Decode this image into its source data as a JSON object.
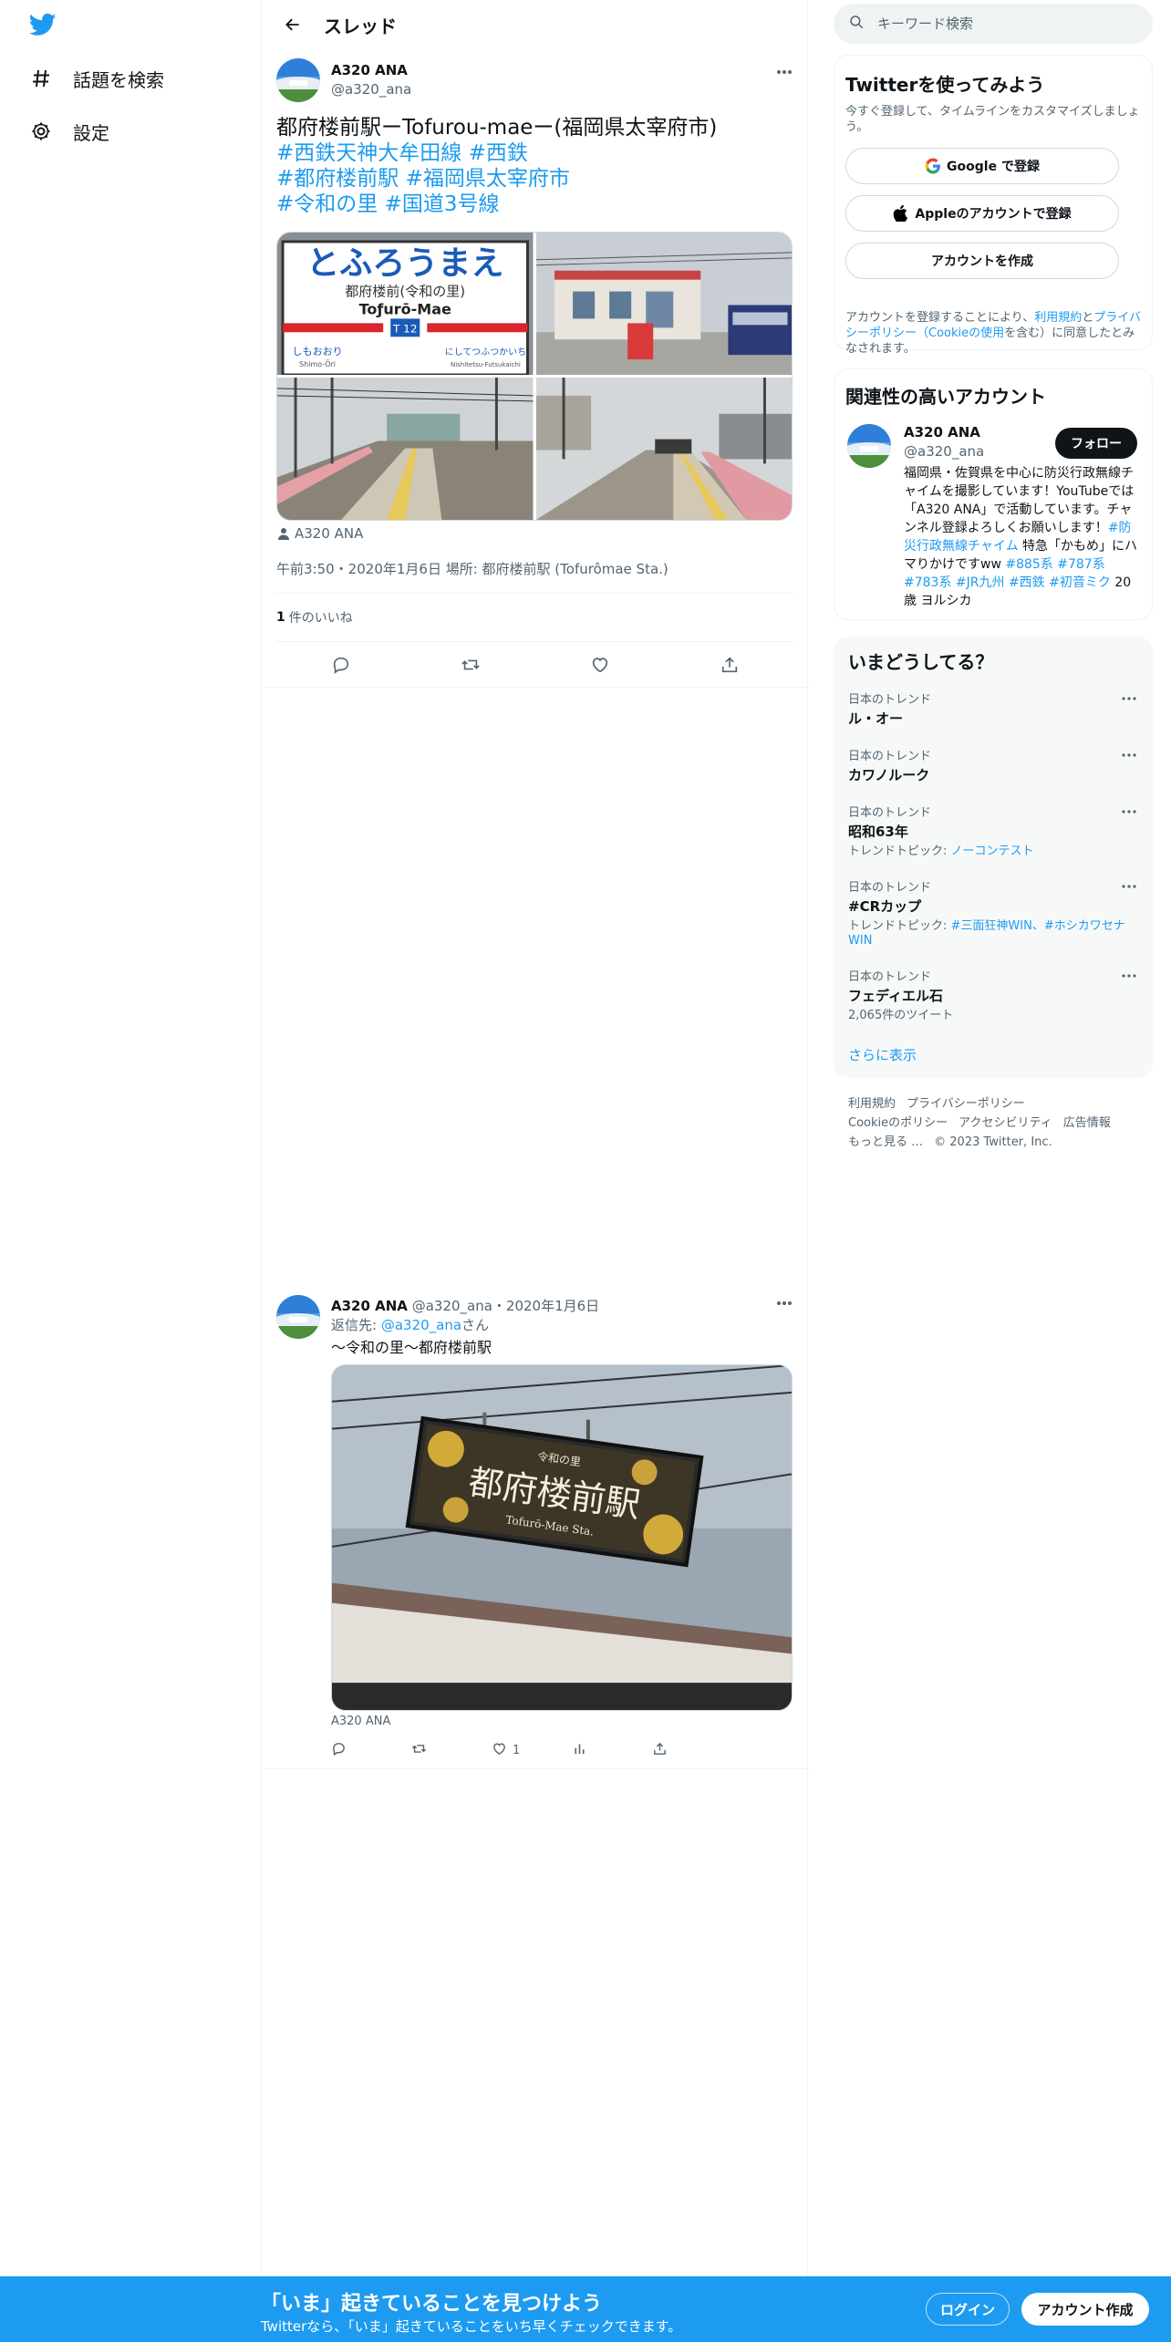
{
  "nav": {
    "explore_label": "話題を検索",
    "settings_label": "設定"
  },
  "header": {
    "title": "スレッド"
  },
  "tweet1": {
    "name": "A320 ANA",
    "handle": "@a320_ana",
    "text_main": "都府楼前駅ーTofurou-maeー(福岡県太宰府市)",
    "hashtags": [
      "#西鉄天神大牟田線",
      "#西鉄",
      "#都府楼前駅",
      "#福岡県太宰府市",
      "#令和の里",
      "#国道3号線"
    ],
    "photo_credit": "A320 ANA",
    "meta": "午前3:50・2020年1月6日 場所: 都府楼前駅 (Tofurômae Sta.)",
    "like_count": "1",
    "like_label": "件のいいね"
  },
  "tweet2": {
    "name": "A320 ANA",
    "handle_date": "@a320_ana・2020年1月6日",
    "reply_prefix": "返信先: ",
    "reply_to": "@a320_ana",
    "reply_suffix": "さん",
    "text": "～令和の里〜都府楼前駅",
    "photo_credit": "A320 ANA",
    "like_count": "1"
  },
  "search": {
    "placeholder": "キーワード検索"
  },
  "signup_card": {
    "title": "Twitterを使ってみよう",
    "subtitle": "今すぐ登録して、タイムラインをカスタマイズしましょう。",
    "google_label": "Google で登録",
    "apple_label": "Appleのアカウントで登録",
    "create_label": "アカウントを作成",
    "terms_prefix": "アカウントを登録することにより、",
    "terms_link1": "利用規約",
    "terms_mid": "と",
    "terms_link2": "プライバシーポリシー（Cookieの使用",
    "terms_suffix": "を含む）に同意したとみなされます。"
  },
  "related": {
    "title": "関連性の高いアカウント",
    "name": "A320 ANA",
    "handle": "@a320_ana",
    "follow_label": "フォロー",
    "bio_part1": "福岡県・佐賀県を中心に防災行政無線チャイムを撮影しています！YouTubeでは「A320 ANA」で活動しています。チャンネル登録よろしくお願いします！",
    "bio_tag1": "#防災行政無線チャイム",
    "bio_part2": " 特急「かもめ」にハマりかけですww ",
    "bio_tags": "#885系 #787系 #783系 #JR九州 #西鉄 #初音ミク",
    "bio_part3": " 20歳 ヨルシカ"
  },
  "trends": {
    "title": "いまどうしてる？",
    "items": [
      {
        "context": "日本のトレンド",
        "title": "ル・オー",
        "topic_prefix": "",
        "topic": ""
      },
      {
        "context": "日本のトレンド",
        "title": "カワノルーク",
        "topic_prefix": "",
        "topic": ""
      },
      {
        "context": "日本のトレンド",
        "title": "昭和63年",
        "topic_prefix": "トレンドトピック: ",
        "topic": "ノーコンテスト"
      },
      {
        "context": "日本のトレンド",
        "title": "#CRカップ",
        "topic_prefix": "トレンドトピック: ",
        "topic": "#三面狂神WIN、#ホシカワセナWIN"
      },
      {
        "context": "日本のトレンド",
        "title": "フェディエル石",
        "topic_prefix": "2,065件のツイート",
        "topic": ""
      }
    ],
    "show_more": "さらに表示"
  },
  "footer": {
    "links": [
      "利用規約",
      "プライバシーポリシー",
      "Cookieのポリシー",
      "アクセシビリティ",
      "広告情報",
      "もっと見る …"
    ],
    "copyright": "© 2023 Twitter, Inc."
  },
  "bottom_bar": {
    "title": "「いま」起きていることを見つけよう",
    "subtitle": "Twitterなら、「いま」起きていることをいち早くチェックできます。",
    "login_label": "ログイン",
    "signup_label": "アカウント作成"
  },
  "photos": {
    "sign_hiragana": "とふろうまえ",
    "sign_kanji": "都府楼前(令和の里)",
    "sign_roman": "Toƒurō-Mae",
    "sign_code": "T 12",
    "sign_left_kana": "しもおおり",
    "sign_left_roman": "Shimo-Ōri",
    "sign_right_kana": "にしてつふつかいち",
    "sign_right_roman": "Nishitetsu-Futsukaichi",
    "board_small": "令和の里",
    "board_main": "都府楼前駅",
    "board_roman": "Tofurō-Mae Sta."
  },
  "colors": {
    "accent": "#1d9bf0",
    "text": "#0f1419",
    "muted": "#536471"
  }
}
